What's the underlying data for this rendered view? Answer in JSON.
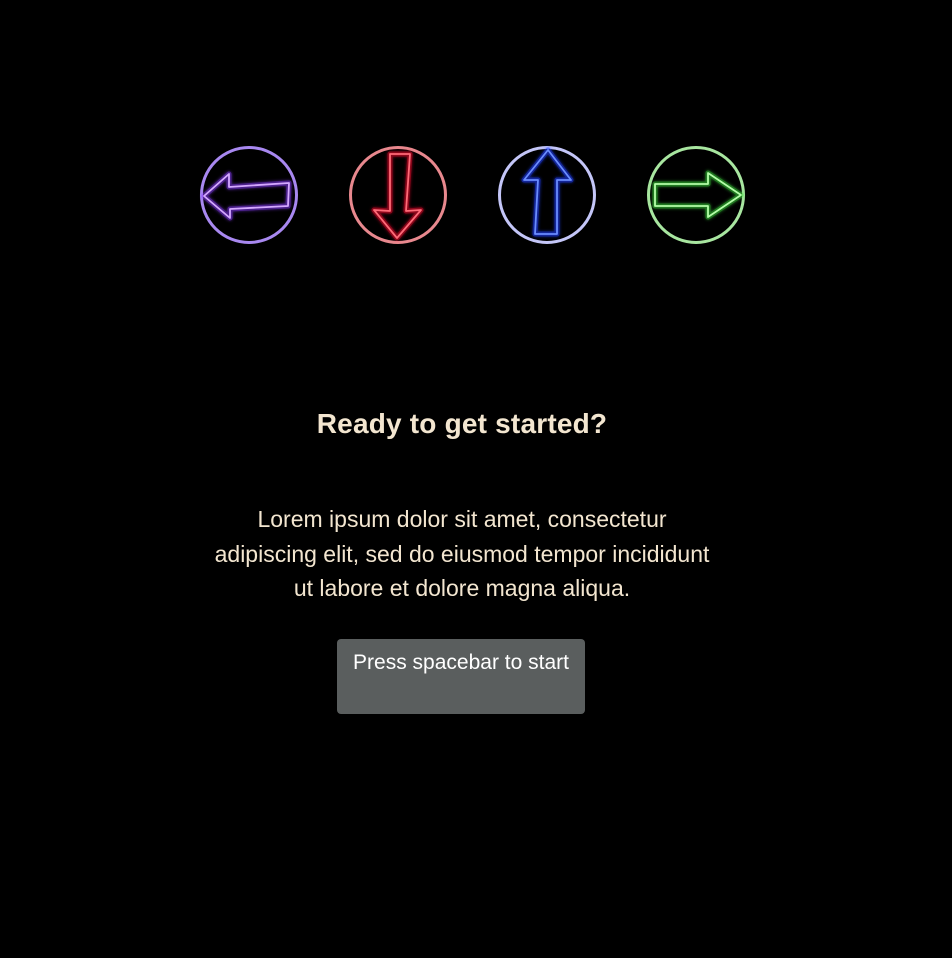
{
  "arrows": [
    {
      "name": "left",
      "icon": "arrow-left-icon",
      "ring_color": "#a888f0",
      "arrow_color": "#b66bff",
      "glow_color": "#8a3cff"
    },
    {
      "name": "down",
      "icon": "arrow-down-icon",
      "ring_color": "#e8888e",
      "arrow_color": "#ff4a5a",
      "glow_color": "#ff1030"
    },
    {
      "name": "up",
      "icon": "arrow-up-icon",
      "ring_color": "#c4c6f8",
      "arrow_color": "#4a6dff",
      "glow_color": "#2040ff"
    },
    {
      "name": "right",
      "icon": "arrow-right-icon",
      "ring_color": "#a8e6a0",
      "arrow_color": "#8cff7a",
      "glow_color": "#3cdc3c"
    }
  ],
  "intro": {
    "title": "Ready to get started?",
    "body": "Lorem ipsum dolor sit amet, consectetur adipiscing elit, sed do eiusmod tempor incididunt ut labore et dolore magna aliqua.",
    "start_label": "Press spacebar to start"
  },
  "colors": {
    "background": "#000000",
    "text": "#f3e6d0",
    "button_bg": "#5a5e5e",
    "button_text": "#ffffff"
  }
}
